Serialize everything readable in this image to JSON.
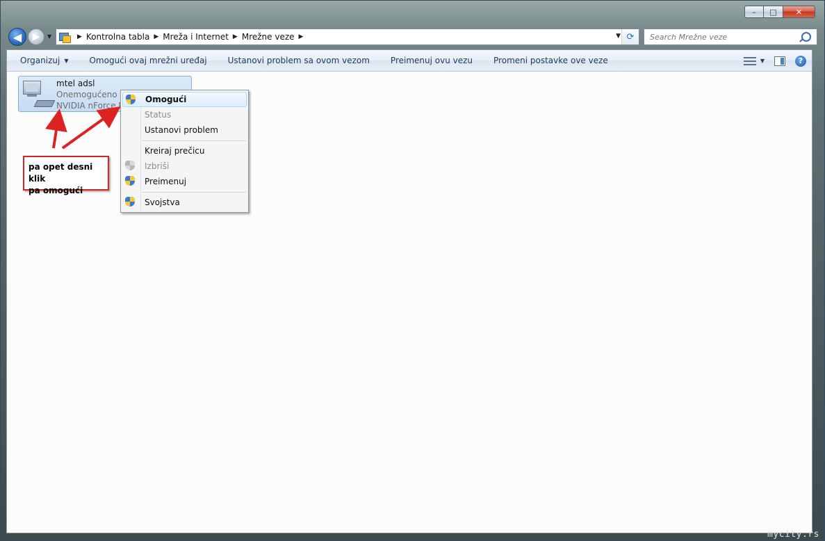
{
  "window": {
    "minimize_symbol": "–",
    "maximize_symbol": "□",
    "close_symbol": "✕"
  },
  "navigation": {
    "back_symbol": "◀",
    "forward_symbol": "▶",
    "breadcrumb": [
      "Kontrolna tabla",
      "Mreža i Internet",
      "Mrežne veze"
    ],
    "search_placeholder": "Search Mrežne veze"
  },
  "toolbar": {
    "buttons": [
      {
        "label": "Organizuj",
        "dropdown": true
      },
      {
        "label": "Omogući ovaj mrežni uređaj"
      },
      {
        "label": "Ustanovi problem sa ovom vezom"
      },
      {
        "label": "Preimenuj ovu vezu"
      },
      {
        "label": "Promeni postavke ove veze"
      }
    ],
    "help_symbol": "?"
  },
  "connection": {
    "name": "mtel adsl",
    "status": "Onemogućeno",
    "device": "NVIDIA nForce Ne"
  },
  "context_menu": {
    "items": [
      {
        "label": "Omogući",
        "icon": "shield-icon",
        "bold": true,
        "disabled": false
      },
      {
        "label": "Status",
        "icon": null,
        "bold": false,
        "disabled": true
      },
      {
        "label": "Ustanovi problem",
        "icon": null,
        "bold": false,
        "disabled": false
      },
      {
        "label": "Kreiraj prečicu",
        "icon": null,
        "bold": false,
        "disabled": false
      },
      {
        "label": "Izbriši",
        "icon": "shield-icon",
        "bold": false,
        "disabled": true
      },
      {
        "label": "Preimenuj",
        "icon": "shield-icon",
        "bold": false,
        "disabled": false
      },
      {
        "label": "Svojstva",
        "icon": "shield-icon",
        "bold": false,
        "disabled": false
      }
    ]
  },
  "annotation": {
    "line1": "pa opet desni klik",
    "line2": "pa omogući",
    "color": "#dd2222"
  },
  "watermark": "mycity.rs"
}
